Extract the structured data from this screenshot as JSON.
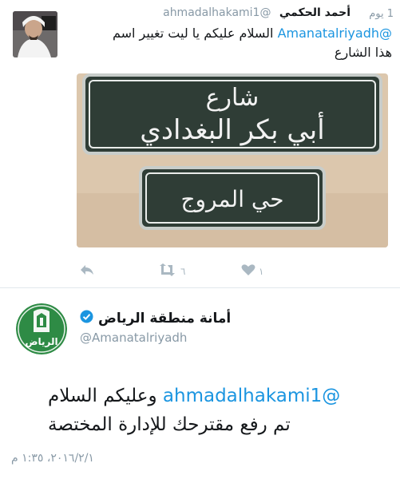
{
  "tweet1": {
    "display_name": "أحمد الحكمي",
    "handle": "@ahmadalhakami1",
    "time": "1 يوم",
    "mention": "@Amanatalriyadh",
    "text_line1": " السلام عليكم يا ليت تغيير اسم",
    "text_line2": "هذا الشارع",
    "photo": {
      "sign_top_line1": "شارع",
      "sign_top_line2": "أبي بكر البغدادي",
      "sign_bottom": "حي المروج"
    },
    "actions": {
      "retweet_count": "٦",
      "like_count": "١"
    }
  },
  "tweet2": {
    "display_name": "أمانة منطقة الرياض",
    "handle": "@Amanatalriyadh",
    "logo_text": "الرياض",
    "mention": "@ahmadalhakami1",
    "text_line1": " وعليكم السلام",
    "text_line2": "تم رفع مقترحك للإدارة المختصة",
    "date": "٢٠١٦/٢/١، ١:٣٥ م"
  },
  "colors": {
    "link": "#1b95e0",
    "sign_green": "#2f3d36",
    "logo_green": "#2e8b45"
  }
}
